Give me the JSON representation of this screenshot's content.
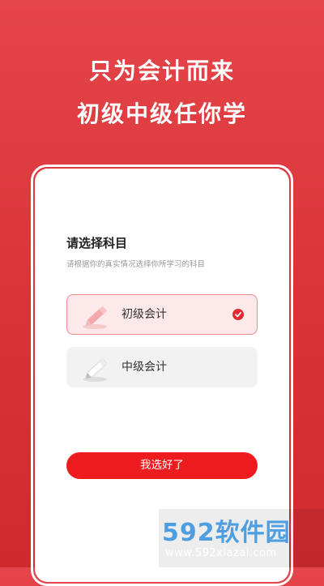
{
  "header": {
    "line1": "只为会计而来",
    "line2": "初级中级任你学"
  },
  "selection": {
    "title": "请选择科目",
    "subtitle": "请根据你的真实情况选择你所学习的科目",
    "options": [
      {
        "label": "初级会计",
        "selected": true,
        "icon": "pencil-icon"
      },
      {
        "label": "中级会计",
        "selected": false,
        "icon": "pencil-icon"
      }
    ],
    "submit_label": "我选好了"
  },
  "watermark": {
    "brand": "592软件园",
    "url": "www.592xiazai.com"
  },
  "colors": {
    "background": "#d93337",
    "accent": "#ee1c1f",
    "selected_bg": "#fde9ea",
    "selected_border": "#ef8a8d"
  }
}
